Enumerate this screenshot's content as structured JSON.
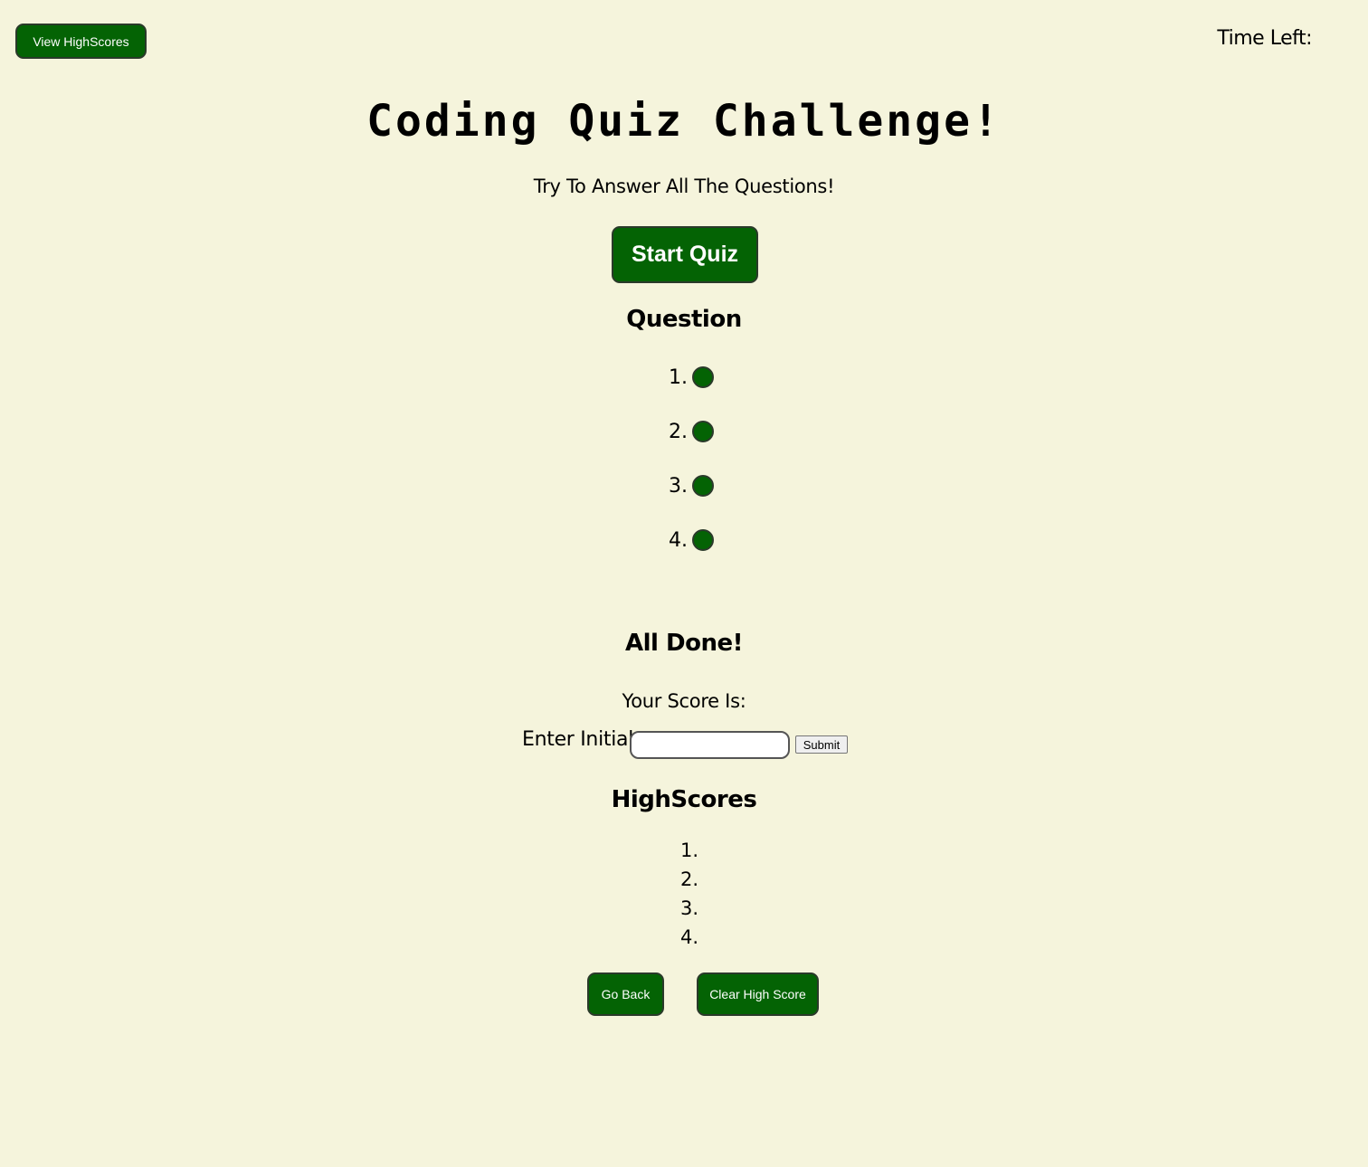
{
  "header": {
    "view_highscores_label": "View HighScores",
    "time_left_label": "Time Left:"
  },
  "intro": {
    "title": "Coding Quiz Challenge!",
    "subtitle": "Try To Answer All The Questions!",
    "start_label": "Start Quiz"
  },
  "question": {
    "heading": "Question",
    "answers": [
      {
        "number": "1."
      },
      {
        "number": "2."
      },
      {
        "number": "3."
      },
      {
        "number": "4."
      }
    ]
  },
  "done": {
    "heading": "All Done!",
    "score_label": "Your Score Is:",
    "initials_label": "Enter Initials",
    "initials_value": "",
    "submit_label": "Submit"
  },
  "highscores": {
    "heading": "HighScores",
    "items": [
      {
        "number": "1."
      },
      {
        "number": "2."
      },
      {
        "number": "3."
      },
      {
        "number": "4."
      }
    ],
    "go_back_label": "Go Back",
    "clear_label": "Clear High Score"
  },
  "colors": {
    "background": "#f5f4dc",
    "accent": "#046304"
  }
}
